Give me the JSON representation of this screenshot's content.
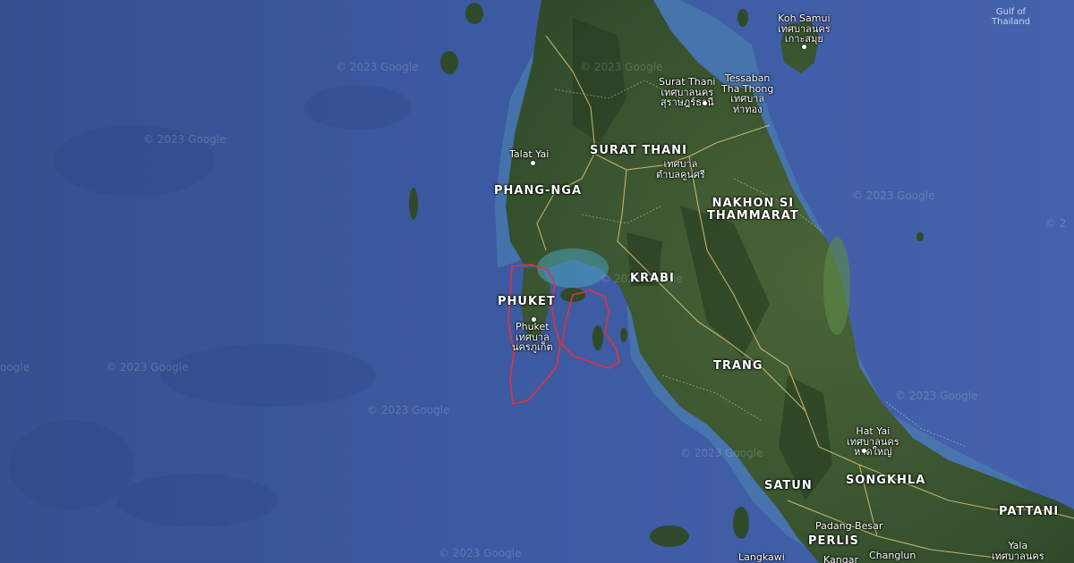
{
  "colors": {
    "sea": "#3d5aa0",
    "land": "#3f5a34",
    "land_dark": "#2f4a2a",
    "shallow": "#4aa3b8",
    "highlight": "#e0333a",
    "province_border": "#e8c878"
  },
  "water_labels": [
    {
      "id": "gulf",
      "text": "Gulf of\nThailand"
    }
  ],
  "provinces": [
    {
      "id": "surat",
      "text": "SURAT THANI"
    },
    {
      "id": "phangnga",
      "text": "PHANG-NGA"
    },
    {
      "id": "nakhon",
      "text": "NAKHON SI\nTHAMMARAT"
    },
    {
      "id": "krabi",
      "text": "KRABI"
    },
    {
      "id": "phuket",
      "text": "PHUKET"
    },
    {
      "id": "trang",
      "text": "TRANG"
    },
    {
      "id": "satun",
      "text": "SATUN"
    },
    {
      "id": "songkhla",
      "text": "SONGKHLA"
    },
    {
      "id": "pattani",
      "text": "PATTANI"
    },
    {
      "id": "perlis",
      "text": "PERLIS"
    }
  ],
  "places": [
    {
      "id": "kohsamui",
      "text": "Koh Samui\nเทศบาลนคร\nเกาะสมุย"
    },
    {
      "id": "suratcity",
      "text": "Surat Thani\nเทศบาลนคร\nสุราษฎร์ธานี"
    },
    {
      "id": "thathong",
      "text": "Tessaban\nTha Thong\nเทศบาล\nท่าทอง"
    },
    {
      "id": "talatyai",
      "text": "Talat Yai"
    },
    {
      "id": "khunsri",
      "text": "เทศบาล\nตำบลคูนศรี"
    },
    {
      "id": "phuketcity",
      "text": "Phuket\nเทศบาล\nนครภูเก็ต"
    },
    {
      "id": "hatyai",
      "text": "Hat Yai\nเทศบาลนคร\nหาดใหญ่"
    },
    {
      "id": "padang",
      "text": "Padang Besar"
    },
    {
      "id": "changlun",
      "text": "Changlun"
    },
    {
      "id": "langkawi",
      "text": "Langkawi"
    },
    {
      "id": "kangar",
      "text": "Kangar"
    },
    {
      "id": "yala",
      "text": "Yala\nเทศบาลนคร"
    }
  ],
  "watermarks": [
    {
      "id": "wm1",
      "text": "© 2023 Google"
    },
    {
      "id": "wm2",
      "text": "© 2023 Google"
    },
    {
      "id": "wm3",
      "text": "© 2023 Google"
    },
    {
      "id": "wm4",
      "text": "© 2023 Google"
    },
    {
      "id": "wm5",
      "text": "© 2023 Google"
    },
    {
      "id": "wm6",
      "text": "© 2023 Google"
    },
    {
      "id": "wm7",
      "text": "© 2023 Google"
    },
    {
      "id": "wm8",
      "text": "© 2023 Google"
    },
    {
      "id": "wm9",
      "text": "© 2023 Google"
    },
    {
      "id": "wm10",
      "text": "© 2023 Google"
    },
    {
      "id": "wm11",
      "text": "oogle"
    },
    {
      "id": "wm12",
      "text": "© 2"
    }
  ]
}
